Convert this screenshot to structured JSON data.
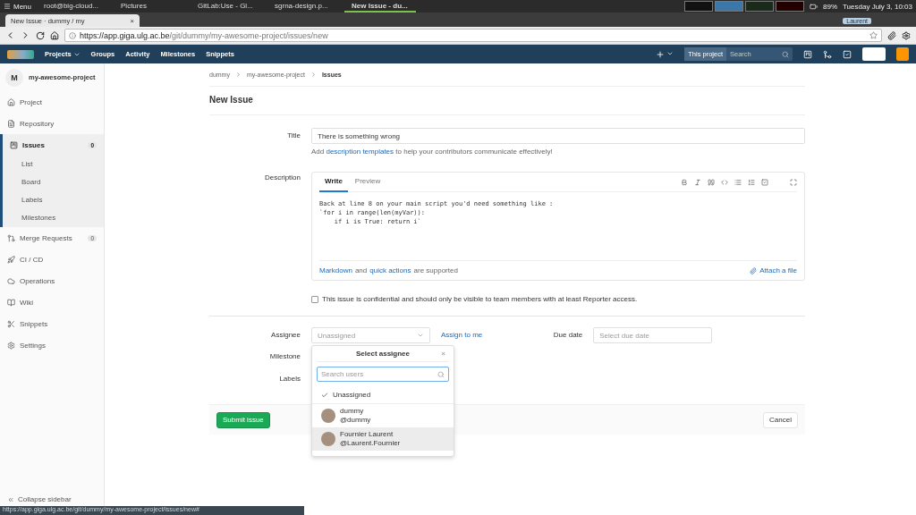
{
  "os_panel": {
    "menu": "Menu",
    "tasks": [
      {
        "label": "root@big-cloud...",
        "selected": false
      },
      {
        "label": "Pictures",
        "selected": false
      },
      {
        "label": "GitLab:Use - Gl...",
        "selected": false
      },
      {
        "label": "sgrna-design.p...",
        "selected": false
      },
      {
        "label": "New Issue - du...",
        "selected": true
      }
    ],
    "battery": "89%",
    "clock": "Tuesday July  3, 10:03"
  },
  "browser": {
    "tab": {
      "title": "New Issue · dummy / my",
      "close": "×"
    },
    "profile": "Laurent",
    "url_host": "https://app.giga.ulg.ac.be",
    "url_path": "/git/dummy/my-awesome-project/issues/new"
  },
  "navbar": {
    "items": [
      "Projects",
      "Groups",
      "Activity",
      "Milestones",
      "Snippets"
    ],
    "scope": "This project",
    "search_placeholder": "Search"
  },
  "sidebar": {
    "avatar": "M",
    "project": "my-awesome-project",
    "items": [
      {
        "label": "Project",
        "selected": false
      },
      {
        "label": "Repository",
        "selected": false
      },
      {
        "label": "Issues",
        "selected": true,
        "count": "0",
        "children": [
          {
            "label": "List"
          },
          {
            "label": "Board"
          },
          {
            "label": "Labels"
          },
          {
            "label": "Milestones"
          }
        ]
      },
      {
        "label": "Merge Requests",
        "selected": false,
        "count": "0"
      },
      {
        "label": "CI / CD",
        "selected": false
      },
      {
        "label": "Operations",
        "selected": false
      },
      {
        "label": "Wiki",
        "selected": false
      },
      {
        "label": "Snippets",
        "selected": false
      },
      {
        "label": "Settings",
        "selected": false
      }
    ],
    "collapse": "Collapse sidebar"
  },
  "breadcrumb": [
    "dummy",
    "my-awesome-project",
    "Issues"
  ],
  "page_title": "New Issue",
  "form": {
    "title_label": "Title",
    "title_value": "There is something wrong",
    "hint_before": "Add",
    "hint_link": "description templates",
    "hint_after": "to help your contributors communicate effectively!",
    "description_label": "Description",
    "editor_tabs": [
      {
        "label": "Write",
        "selected": true
      },
      {
        "label": "Preview",
        "selected": false
      }
    ],
    "description_value": "Back at line 8 on your main script you'd need something like :\n`for i in range(len(myVar)):\n    if i is True: return i`",
    "markdown_link": "Markdown",
    "and": "and",
    "quick_actions": "quick actions",
    "supported": "are supported",
    "attach": "Attach a file",
    "confidential": {
      "label": "This issue is confidential and should only be visible to team members with at least Reporter access.",
      "checked": false
    },
    "assignee_label": "Assignee",
    "assignee_value": "Unassigned",
    "assign_me": "Assign to me",
    "due_label": "Due date",
    "due_placeholder": "Select due date",
    "milestone_label": "Milestone",
    "labels_label": "Labels",
    "submit": "Submit issue",
    "cancel": "Cancel"
  },
  "assignee_dropdown": {
    "title": "Select assignee",
    "close": "×",
    "search_placeholder": "Search users",
    "options": [
      {
        "name": "Unassigned",
        "checked": true,
        "selected": false
      },
      {
        "name": "dummy",
        "username": "@dummy",
        "checked": false,
        "selected": false
      },
      {
        "name": "Fournier Laurent",
        "username": "@Laurent.Fournier",
        "checked": false,
        "selected": true
      }
    ]
  },
  "status_url": "https://app.giga.ulg.ac.be/git/dummy/my-awesome-project/issues/new#"
}
